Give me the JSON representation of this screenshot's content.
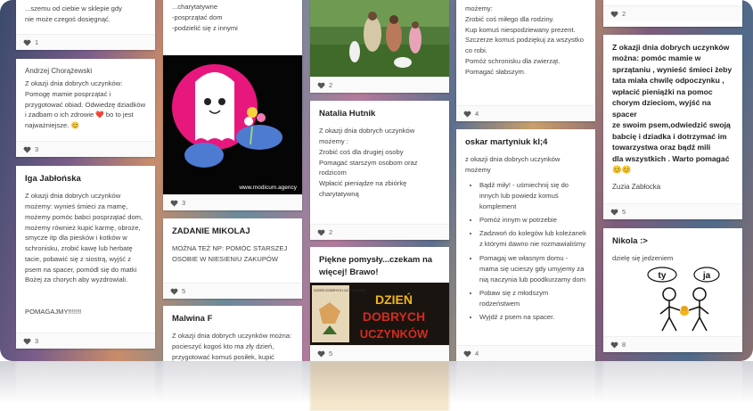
{
  "col1": {
    "card1": {
      "text": "...szemu od ciebie w sklepie gdy\nnie może czegoś dosięgnąć.",
      "likes": "1"
    },
    "card2": {
      "author": "Andrzej Chorążewski",
      "text": "Z okazji dnia dobrych uczynków:\nPomogę mamie posprzątać i\nprzygotować obiad. Odwiedzę dziadków\ni zadbam o ich zdrowie ❤️ bo to jest\nnajważniejsze. 😊",
      "likes": "3"
    },
    "card3": {
      "title": "Iga Jabłońska",
      "text": "Z okazji dnia dobrych uczynków\nmożemy: wynieś śmieci za mamę,\nmożemy pomóc babci posprzątać dom,\nmożemy również kupić karmę, obroże,\nsmycze itp dla piesków i kotków w\nschronisku, zrobić kawę lub herbatę\ntacie, pobawić się z siostrą, wyjść z\npsem na spacer, pomódl się do matki\nBożej za chorych aby wyzdrowiali.\n\n\nPOMAGAJMY!!!!!!!",
      "likes": "3"
    }
  },
  "col2": {
    "card1": {
      "text": "...charytatywne\n-posprzątać dom\n-podzielić się z innymi",
      "caption": "www.modicum.agency",
      "likes": "3"
    },
    "card2": {
      "title": "ZADANIE MIKOLAJ",
      "text": "MOŻNA TEŻ NP: POMÓC STARSZEJ\nOSOBIE W NIESIENIU ZAKUPÓW",
      "likes": "5"
    },
    "card3": {
      "title": "Malwina F",
      "text": "Z okazji dnia dobrych uczynków można:\npocieszyć kogoś kto ma zły dzień,\nprzygotować komuś posiłek, kupić"
    }
  },
  "col3": {
    "card1": {
      "likes": "2"
    },
    "card2": {
      "title": "Natalia Hutnik",
      "text": "Z okazji dnia dobrych uczynków\nmożemy :\nZrobić coś dla drugiej osoby\nPomagać starszym osobom oraz\nrodzicom\nWpłacić pieniądze na zbiórkę\ncharytatywną",
      "likes": "2"
    },
    "card3": {
      "title": "Piękne pomysły...czekam na\nwięcej! Brawo!",
      "poster_small": "DZIEŃ\nDOBRYCH\nUCZYNKÓW",
      "poster_line1": "DZIEŃ",
      "poster_line2": "DOBRYCH",
      "poster_line3": "UCZYNKÓW",
      "likes": "5"
    }
  },
  "col4": {
    "card1": {
      "text": "możemy:\nZrobić coś miłego  dla rodziny.\nKup komuś niespodziewany prezent.\nSzczerze  komuś podziękuj  za wszystko\nco robi.\nPomóż  schronisku dla zwierząt.\nPomagać słabszym.",
      "likes": "4"
    },
    "card2": {
      "title": "oskar martyniuk kl;4",
      "intro": "z okazji dnia dobrych uczynków\nmożemy",
      "bullets": [
        "Bądź miły! - uśmiechnij się do innych lub powiedz komuś komplement",
        "Pomóż innym w potrzebie",
        "Zadzwoń  do kolegów lub koleżanek z którymi dawno nie rozmawialiśmy",
        "Pomagaj we własnym domu - mama się ucieszy gdy umyjemy  za nią naczynia lub poodkurzamy dom",
        "Pobaw się z młodszym rodzeństwem",
        "Wyjdź z psem na spacer."
      ],
      "likes": "4"
    }
  },
  "col5": {
    "card1": {
      "likes": "2"
    },
    "card2": {
      "text": "Z okazji dnia dobrych uczynków\nmożna: pomóc mamie w\nsprzątaniu , wynieść śmieci żeby\ntata miała chwilę odpoczynku ,\nwpłacić pieniążki na pomoc\nchorym dzieciom, wyjść na spacer\nze swoim psem,odwiedzić swoją\nbabcię i dziadka i dotrzymać im\ntowarzystwa oraz bądź mili\ndla wszystkich . Warto pomagać\n😊😊",
      "author": "Zuzia Zabłocka",
      "likes": "5"
    },
    "card3": {
      "title": "Nikola :>",
      "text": "dzielę się jedzeniem",
      "bubble1": "ty",
      "bubble2": "ja",
      "likes": "8"
    }
  },
  "colors": {
    "heart": "#555555",
    "card_bg": "#ffffff",
    "footer_bg": "#fafafa",
    "poster_red": "#d12c1e",
    "poster_gold": "#f1b51c"
  }
}
